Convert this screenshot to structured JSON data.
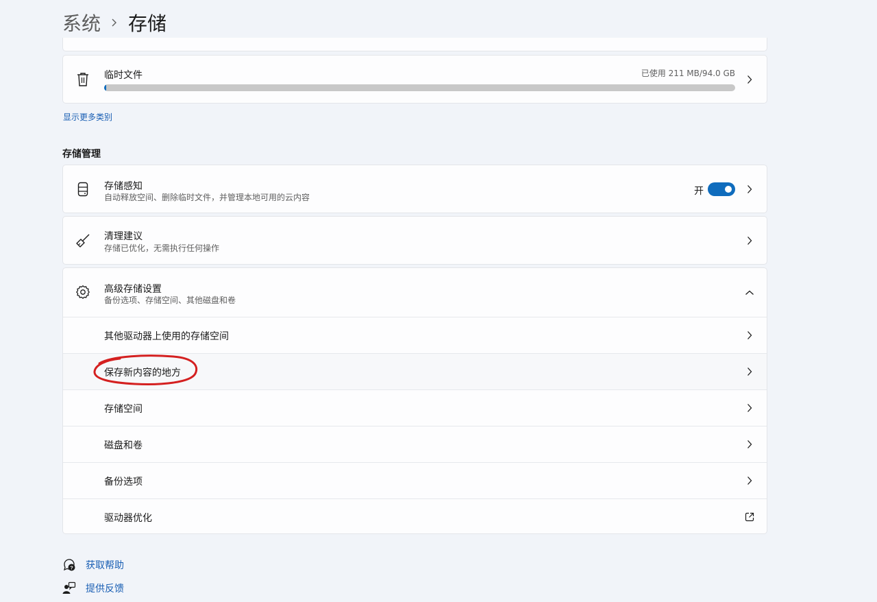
{
  "header": {
    "parent": "系统",
    "current": "存储"
  },
  "temp_files": {
    "title": "临时文件",
    "usage": "已使用 211 MB/94.0 GB",
    "used_fraction": 0.0022
  },
  "show_more": "显示更多类别",
  "storage_management": {
    "section_title": "存储管理",
    "storage_sense": {
      "title": "存储感知",
      "subtitle": "自动释放空间、删除临时文件，并管理本地可用的云内容",
      "toggle_label": "开",
      "toggle_on": true
    },
    "cleanup": {
      "title": "清理建议",
      "subtitle": "存储已优化，无需执行任何操作"
    },
    "advanced": {
      "title": "高级存储设置",
      "subtitle": "备份选项、存储空间、其他磁盘和卷",
      "expanded": true,
      "items": [
        {
          "label": "其他驱动器上使用的存储空间",
          "icon": "chevron-right-icon"
        },
        {
          "label": "保存新内容的地方",
          "icon": "chevron-right-icon"
        },
        {
          "label": "存储空间",
          "icon": "chevron-right-icon"
        },
        {
          "label": "磁盘和卷",
          "icon": "chevron-right-icon"
        },
        {
          "label": "备份选项",
          "icon": "chevron-right-icon"
        },
        {
          "label": "驱动器优化",
          "icon": "external-link-icon"
        }
      ]
    }
  },
  "footer": {
    "help": "获取帮助",
    "feedback": "提供反馈"
  },
  "colors": {
    "accent": "#0f6cbd",
    "link": "#1a5fb4",
    "annotation": "#d42020",
    "background": "#f1f4f9"
  }
}
